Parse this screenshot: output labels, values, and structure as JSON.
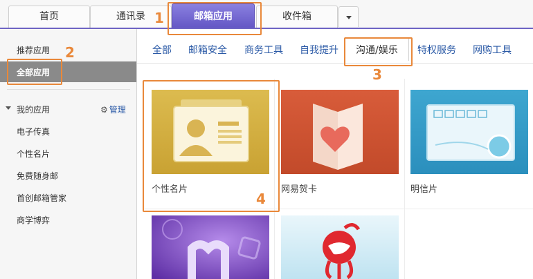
{
  "top_tabs": [
    {
      "label": "首页"
    },
    {
      "label": "通讯录"
    },
    {
      "label": "邮箱应用",
      "active": true
    },
    {
      "label": "收件箱"
    }
  ],
  "sidebar": {
    "recommended": "推荐应用",
    "all_apps": "全部应用",
    "my_apps": "我的应用",
    "manage": "管理",
    "items": [
      "电子传真",
      "个性名片",
      "免费随身邮",
      "首创邮箱管家",
      "商学博弈"
    ]
  },
  "categories": [
    "全部",
    "邮箱安全",
    "商务工具",
    "自我提升",
    "沟通/娱乐",
    "特权服务",
    "网购工具"
  ],
  "active_category": "沟通/娱乐",
  "apps": [
    {
      "label": "个性名片",
      "icon": "id-card-icon"
    },
    {
      "label": "网易贺卡",
      "icon": "greeting-card-icon"
    },
    {
      "label": "明信片",
      "icon": "postcard-icon"
    },
    {
      "label": "",
      "icon": "m-logo-icon"
    },
    {
      "label": "",
      "icon": "mascot-icon"
    }
  ],
  "annotations": [
    "1",
    "2",
    "3",
    "4"
  ],
  "colors": {
    "accent": "#6e64c4",
    "annotation": "#e9883a",
    "link": "#2a59a6"
  }
}
